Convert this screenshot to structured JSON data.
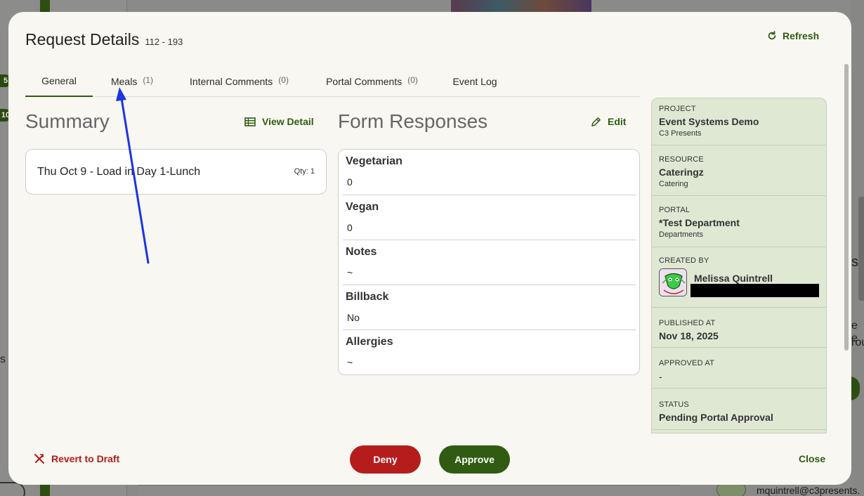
{
  "background": {
    "badges": [
      "5",
      "10"
    ],
    "side_text_left": "s",
    "side_text_right_top": "s",
    "side_text_right_mid1": "e e",
    "side_text_right_mid2": "rou",
    "email": "mquintrell@c3presents."
  },
  "modal": {
    "title": "Request Details",
    "title_range": "112 - 193",
    "refresh_label": "Refresh"
  },
  "tabs": [
    {
      "label": "General",
      "count": ""
    },
    {
      "label": "Meals",
      "count": "(1)"
    },
    {
      "label": "Internal Comments",
      "count": "(0)"
    },
    {
      "label": "Portal Comments",
      "count": "(0)"
    },
    {
      "label": "Event Log",
      "count": ""
    }
  ],
  "summary": {
    "title": "Summary",
    "view_detail_label": "View Detail",
    "item_text": "Thu Oct 9 - Load in Day 1-Lunch",
    "item_qty": "Qty: 1"
  },
  "form_responses": {
    "title": "Form Responses",
    "edit_label": "Edit",
    "items": [
      {
        "label": "Vegetarian",
        "value": "0"
      },
      {
        "label": "Vegan",
        "value": "0"
      },
      {
        "label": "Notes",
        "value": "~"
      },
      {
        "label": "Billback",
        "value": "No"
      },
      {
        "label": "Allergies",
        "value": "~"
      }
    ]
  },
  "details": {
    "project": {
      "label": "PROJECT",
      "value": "Event Systems Demo",
      "sub": "C3 Presents"
    },
    "resource": {
      "label": "RESOURCE",
      "value": "Cateringz",
      "sub": "Catering"
    },
    "portal": {
      "label": "PORTAL",
      "value": "*Test Department",
      "sub": "Departments"
    },
    "created_by": {
      "label": "CREATED BY",
      "name": "Melissa Quintrell"
    },
    "published_at": {
      "label": "PUBLISHED AT",
      "value": "Nov 18, 2025"
    },
    "approved_at": {
      "label": "APPROVED AT",
      "value": "-"
    },
    "status": {
      "label": "STATUS",
      "value": "Pending Portal Approval"
    }
  },
  "footer": {
    "revert_label": "Revert to Draft",
    "deny_label": "Deny",
    "approve_label": "Approve",
    "close_label": "Close"
  },
  "colors": {
    "accent_green": "#2f5c12",
    "danger_red": "#b51d1d",
    "annotation_arrow": "#1a34e8",
    "side_panel_bg": "#dfe8d3"
  }
}
